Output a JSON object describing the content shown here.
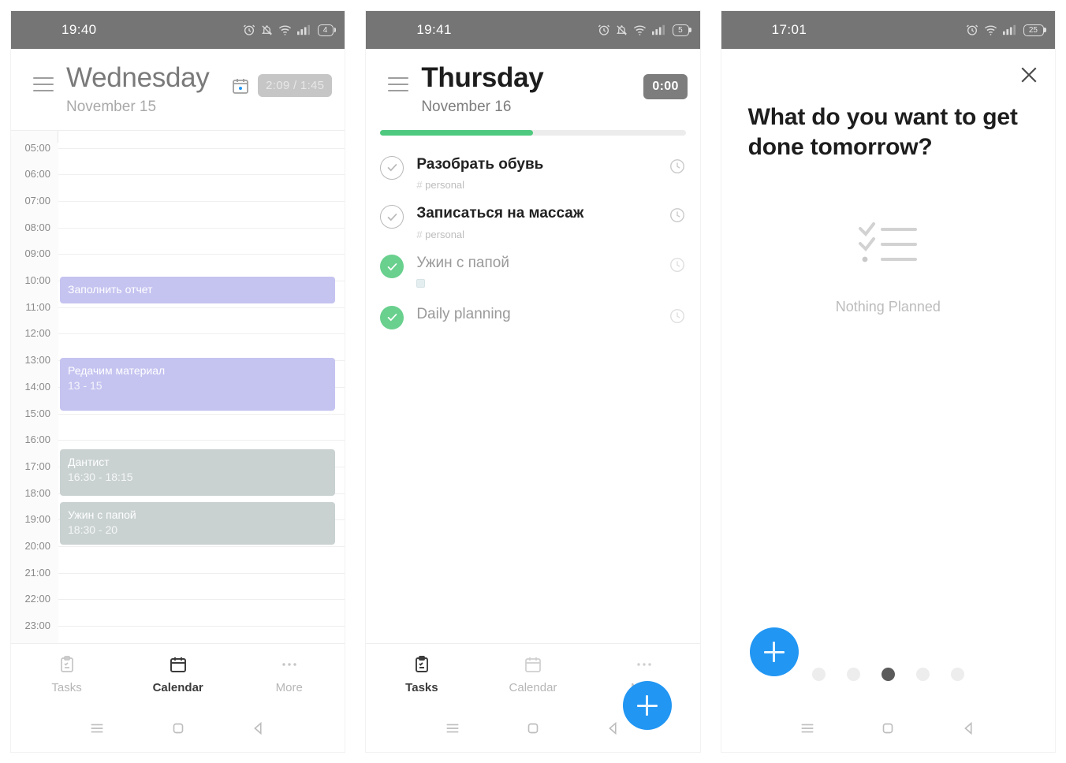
{
  "screens": [
    {
      "id": "calendar-day",
      "statusbar": {
        "time": "19:40",
        "battery": "4",
        "icons": [
          "alarm-icon",
          "bell-off-icon",
          "wifi-icon",
          "signal-icon",
          "battery-icon"
        ]
      },
      "header": {
        "title": "Wednesday",
        "subtitle": "November 15",
        "timer": "2:09 / 1:45",
        "menu_icon": "hamburger-menu-icon",
        "calendar_icon": "calendar-icon"
      },
      "hours": [
        "05:00",
        "06:00",
        "07:00",
        "08:00",
        "09:00",
        "10:00",
        "11:00",
        "12:00",
        "13:00",
        "14:00",
        "15:00",
        "16:00",
        "17:00",
        "18:00",
        "19:00",
        "20:00",
        "21:00",
        "22:00",
        "23:00"
      ],
      "events": [
        {
          "title": "Заполнить отчет",
          "time": "",
          "color": "#c5c3f0",
          "start_hour": 9.85,
          "end_hour": 10.85
        },
        {
          "title": "Редачим материал",
          "time": "13 - 15",
          "color": "#c5c3f0",
          "start_hour": 12.9,
          "end_hour": 14.9
        },
        {
          "title": "Дантист",
          "time": "16:30 - 18:15",
          "color": "#c9d1d1",
          "start_hour": 16.35,
          "end_hour": 18.1
        },
        {
          "title": "Ужин с папой",
          "time": "18:30 - 20",
          "color": "#c9d1d1",
          "start_hour": 18.35,
          "end_hour": 19.95
        }
      ],
      "bottomnav": {
        "items": [
          {
            "label": "Tasks",
            "icon": "clipboard-icon",
            "active": false
          },
          {
            "label": "Calendar",
            "icon": "calendar-icon",
            "active": true
          },
          {
            "label": "More",
            "icon": "ellipsis-icon",
            "active": false
          }
        ]
      }
    },
    {
      "id": "tasks-day",
      "statusbar": {
        "time": "19:41",
        "battery": "5",
        "icons": [
          "alarm-icon",
          "bell-off-icon",
          "wifi-icon",
          "signal-icon",
          "battery-icon"
        ]
      },
      "header": {
        "title": "Thursday",
        "subtitle": "November 16",
        "timer": "0:00",
        "menu_icon": "hamburger-menu-icon",
        "progress_percent": 50,
        "progress_color": "#4ec97f"
      },
      "tasks": [
        {
          "title": "Разобрать обувь",
          "tag": "personal",
          "done": false,
          "clock_icon": "clock-icon"
        },
        {
          "title": "Записаться на массаж",
          "tag": "personal",
          "done": false,
          "clock_icon": "clock-icon"
        },
        {
          "title": "Ужин с папой",
          "tag": "",
          "done": true,
          "has_tag_chip": true,
          "clock_icon": "clock-icon"
        },
        {
          "title": "Daily planning",
          "tag": "",
          "done": true,
          "clock_icon": "clock-icon"
        }
      ],
      "fab": {
        "icon": "plus-icon",
        "color": "#2196f3"
      },
      "bottomnav": {
        "items": [
          {
            "label": "Tasks",
            "icon": "clipboard-icon",
            "active": true
          },
          {
            "label": "Calendar",
            "icon": "calendar-icon",
            "active": false
          },
          {
            "label": "More",
            "icon": "ellipsis-icon",
            "active": false
          }
        ]
      }
    },
    {
      "id": "plan-tomorrow",
      "statusbar": {
        "time": "17:01",
        "battery": "25",
        "icons": [
          "alarm-icon",
          "wifi-icon",
          "signal-icon",
          "battery-icon"
        ]
      },
      "close_icon": "close-icon",
      "question": "What do you want to get done tomorrow?",
      "empty_state": {
        "icon": "checklist-icon",
        "label": "Nothing Planned"
      },
      "fab": {
        "icon": "plus-icon",
        "color": "#2196f3"
      },
      "pager": {
        "count": 5,
        "active_index": 2
      }
    }
  ],
  "system_nav": {
    "recent": "menu-icon",
    "home": "square-icon",
    "back": "back-triangle-icon"
  }
}
